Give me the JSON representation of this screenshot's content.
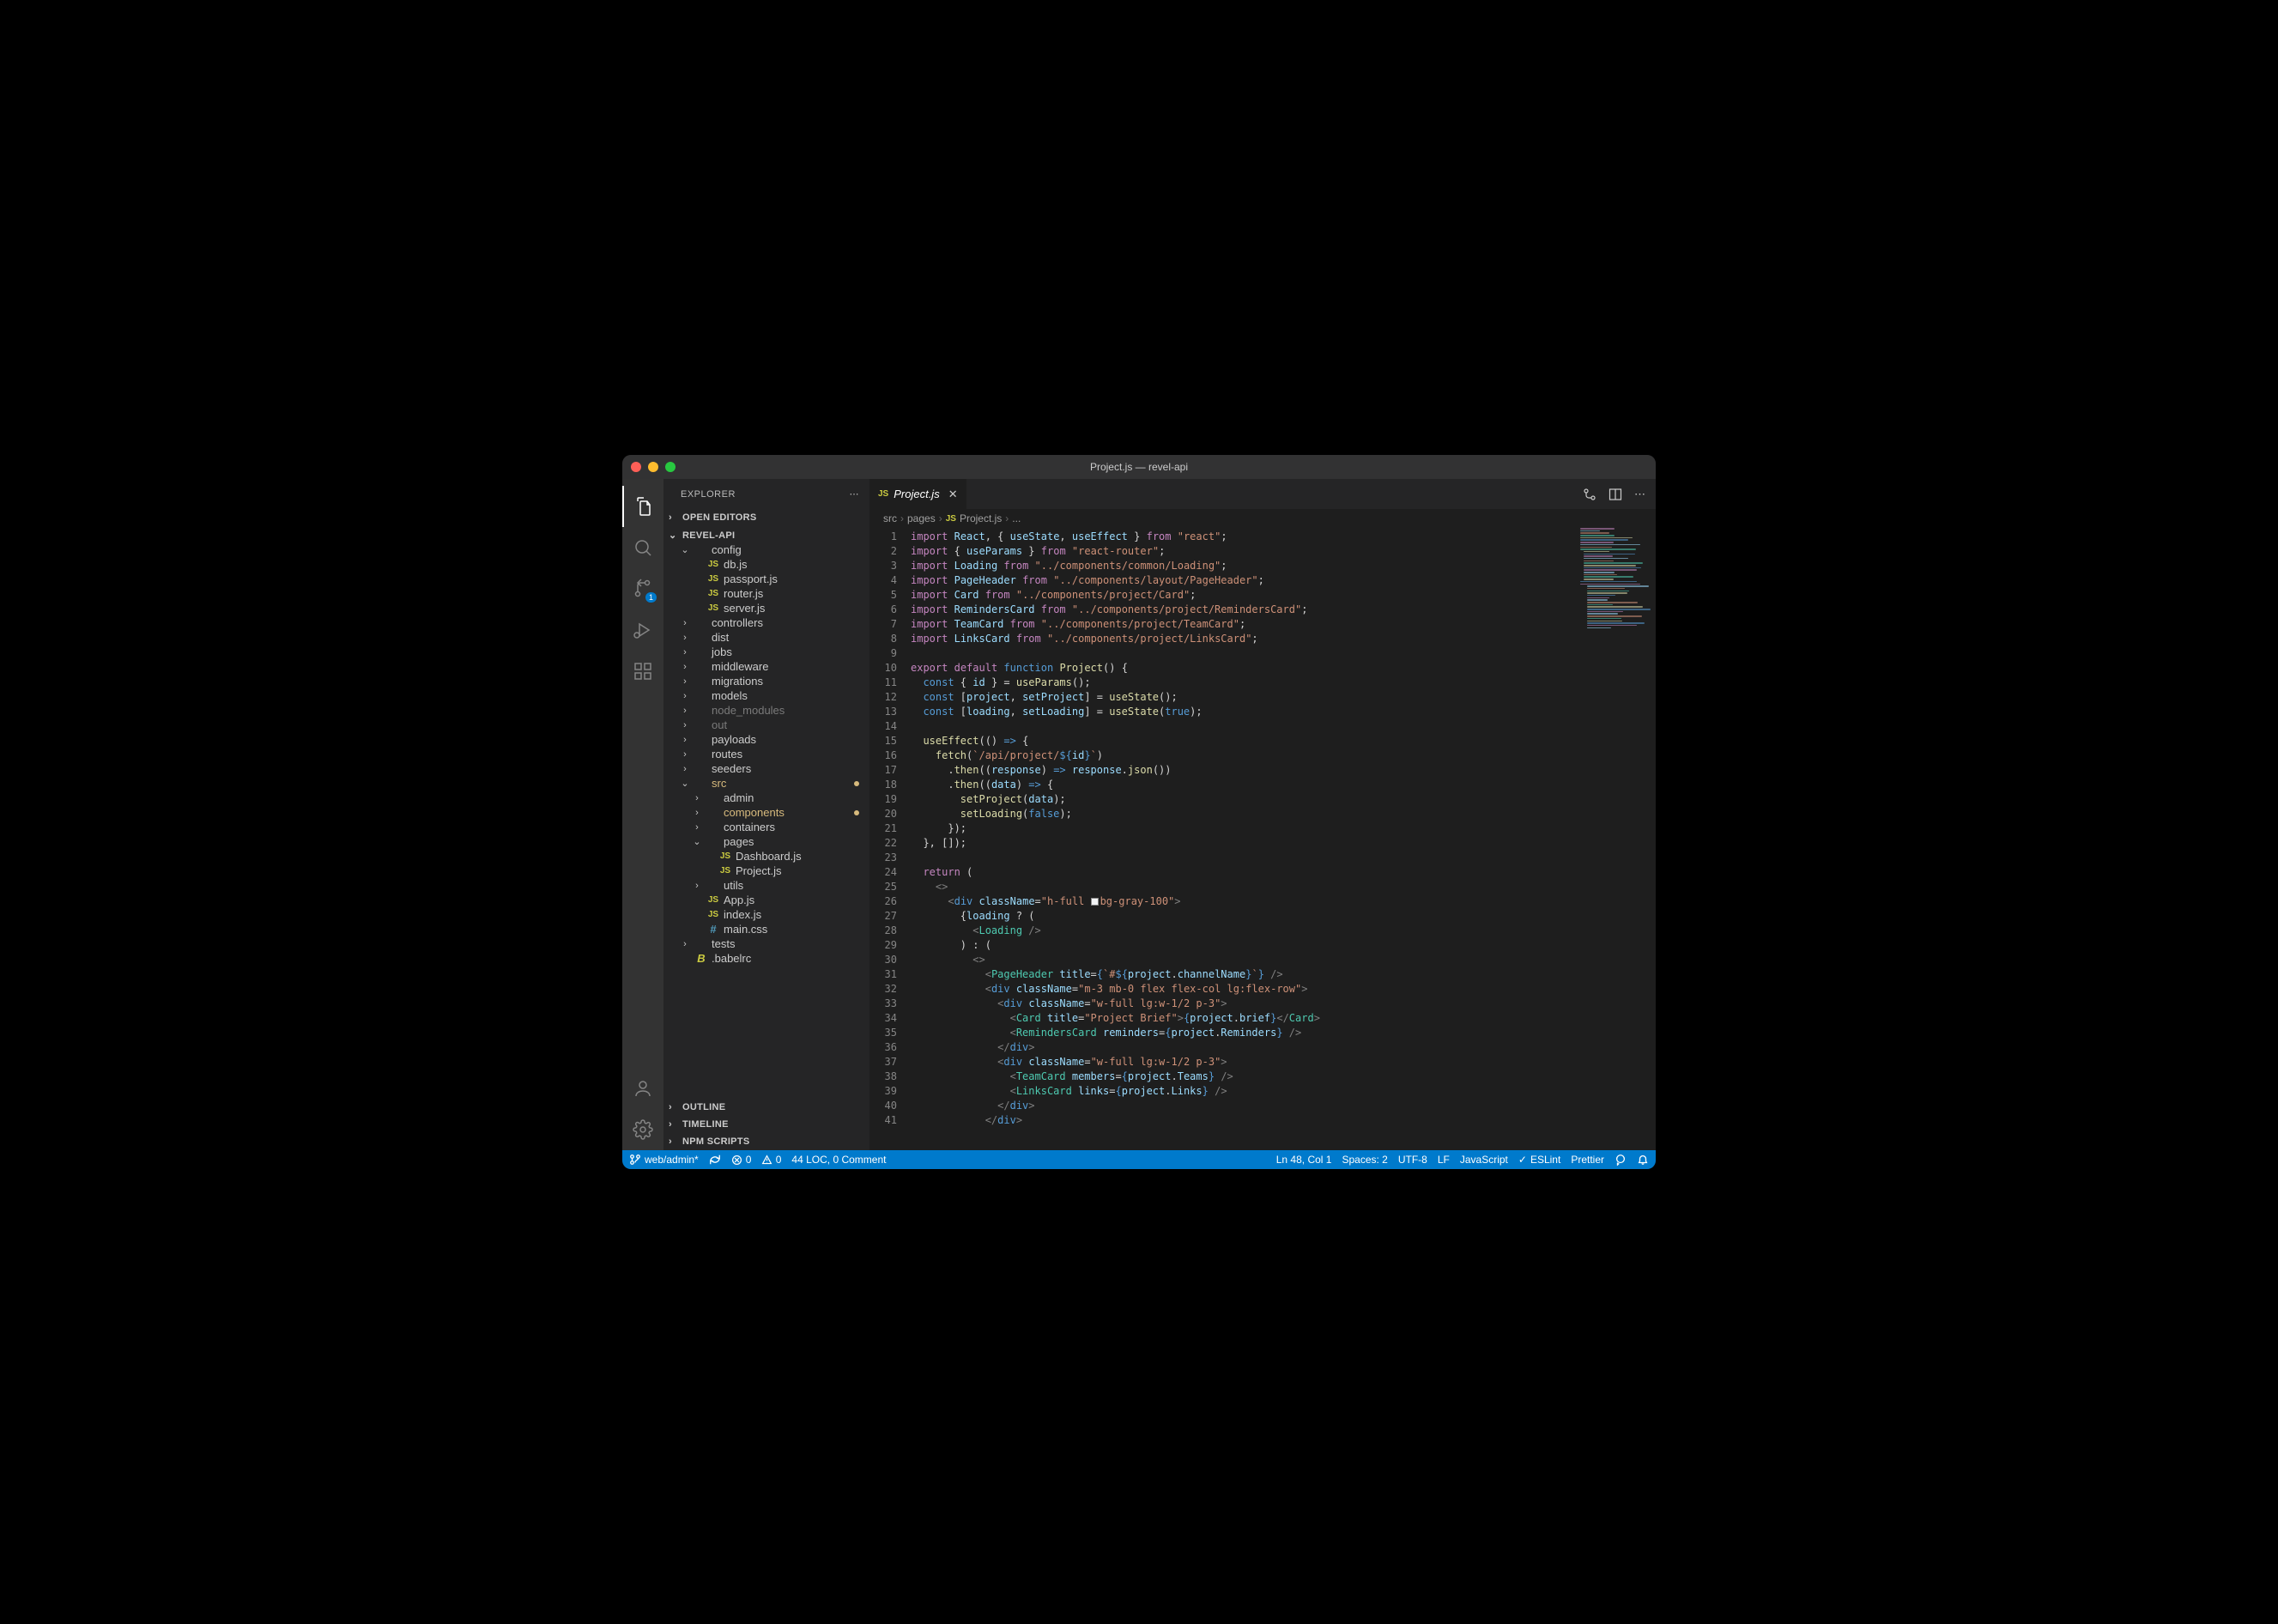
{
  "titlebar": {
    "title": "Project.js — revel-api"
  },
  "sidebar": {
    "title": "EXPLORER",
    "sections": {
      "open_editors": "OPEN EDITORS",
      "project": "REVEL-API",
      "outline": "OUTLINE",
      "timeline": "TIMELINE",
      "npm": "NPM SCRIPTS"
    },
    "tree": [
      {
        "d": 1,
        "t": "folder",
        "open": true,
        "label": "config"
      },
      {
        "d": 2,
        "t": "js",
        "label": "db.js"
      },
      {
        "d": 2,
        "t": "js",
        "label": "passport.js"
      },
      {
        "d": 2,
        "t": "js",
        "label": "router.js"
      },
      {
        "d": 2,
        "t": "js",
        "label": "server.js"
      },
      {
        "d": 1,
        "t": "folder",
        "label": "controllers"
      },
      {
        "d": 1,
        "t": "folder",
        "label": "dist"
      },
      {
        "d": 1,
        "t": "folder",
        "label": "jobs"
      },
      {
        "d": 1,
        "t": "folder",
        "label": "middleware"
      },
      {
        "d": 1,
        "t": "folder",
        "label": "migrations"
      },
      {
        "d": 1,
        "t": "folder",
        "label": "models"
      },
      {
        "d": 1,
        "t": "folder",
        "label": "node_modules",
        "dim": true
      },
      {
        "d": 1,
        "t": "folder",
        "label": "out",
        "dim": true
      },
      {
        "d": 1,
        "t": "folder",
        "label": "payloads"
      },
      {
        "d": 1,
        "t": "folder",
        "label": "routes"
      },
      {
        "d": 1,
        "t": "folder",
        "label": "seeders"
      },
      {
        "d": 1,
        "t": "folder",
        "open": true,
        "label": "src",
        "mod": true,
        "dot": true
      },
      {
        "d": 2,
        "t": "folder",
        "label": "admin"
      },
      {
        "d": 2,
        "t": "folder",
        "label": "components",
        "mod": true,
        "dot": true
      },
      {
        "d": 2,
        "t": "folder",
        "label": "containers"
      },
      {
        "d": 2,
        "t": "folder",
        "open": true,
        "label": "pages"
      },
      {
        "d": 3,
        "t": "js",
        "label": "Dashboard.js"
      },
      {
        "d": 3,
        "t": "js",
        "label": "Project.js"
      },
      {
        "d": 2,
        "t": "folder",
        "label": "utils"
      },
      {
        "d": 2,
        "t": "js",
        "label": "App.js"
      },
      {
        "d": 2,
        "t": "js",
        "label": "index.js"
      },
      {
        "d": 2,
        "t": "hash",
        "label": "main.css"
      },
      {
        "d": 1,
        "t": "folder",
        "label": "tests"
      },
      {
        "d": 1,
        "t": "babel",
        "label": ".babelrc"
      }
    ]
  },
  "scm_badge": "1",
  "tab": {
    "label": "Project.js"
  },
  "breadcrumb": [
    "src",
    "pages",
    "Project.js",
    "..."
  ],
  "code_lines": [
    [
      [
        "kw",
        "import"
      ],
      [
        "pun",
        " "
      ],
      [
        "id",
        "React"
      ],
      [
        "pun",
        ", { "
      ],
      [
        "id",
        "useState"
      ],
      [
        "pun",
        ", "
      ],
      [
        "id",
        "useEffect"
      ],
      [
        "pun",
        " } "
      ],
      [
        "kw",
        "from"
      ],
      [
        "pun",
        " "
      ],
      [
        "str",
        "\"react\""
      ],
      [
        "pun",
        ";"
      ]
    ],
    [
      [
        "kw",
        "import"
      ],
      [
        "pun",
        " { "
      ],
      [
        "id",
        "useParams"
      ],
      [
        "pun",
        " } "
      ],
      [
        "kw",
        "from"
      ],
      [
        "pun",
        " "
      ],
      [
        "str",
        "\"react-router\""
      ],
      [
        "pun",
        ";"
      ]
    ],
    [
      [
        "kw",
        "import"
      ],
      [
        "pun",
        " "
      ],
      [
        "id",
        "Loading"
      ],
      [
        "pun",
        " "
      ],
      [
        "kw",
        "from"
      ],
      [
        "pun",
        " "
      ],
      [
        "str",
        "\"../components/common/Loading\""
      ],
      [
        "pun",
        ";"
      ]
    ],
    [
      [
        "kw",
        "import"
      ],
      [
        "pun",
        " "
      ],
      [
        "id",
        "PageHeader"
      ],
      [
        "pun",
        " "
      ],
      [
        "kw",
        "from"
      ],
      [
        "pun",
        " "
      ],
      [
        "str",
        "\"../components/layout/PageHeader\""
      ],
      [
        "pun",
        ";"
      ]
    ],
    [
      [
        "kw",
        "import"
      ],
      [
        "pun",
        " "
      ],
      [
        "id",
        "Card"
      ],
      [
        "pun",
        " "
      ],
      [
        "kw",
        "from"
      ],
      [
        "pun",
        " "
      ],
      [
        "str",
        "\"../components/project/Card\""
      ],
      [
        "pun",
        ";"
      ]
    ],
    [
      [
        "kw",
        "import"
      ],
      [
        "pun",
        " "
      ],
      [
        "id",
        "RemindersCard"
      ],
      [
        "pun",
        " "
      ],
      [
        "kw",
        "from"
      ],
      [
        "pun",
        " "
      ],
      [
        "str",
        "\"../components/project/RemindersCard\""
      ],
      [
        "pun",
        ";"
      ]
    ],
    [
      [
        "kw",
        "import"
      ],
      [
        "pun",
        " "
      ],
      [
        "id",
        "TeamCard"
      ],
      [
        "pun",
        " "
      ],
      [
        "kw",
        "from"
      ],
      [
        "pun",
        " "
      ],
      [
        "str",
        "\"../components/project/TeamCard\""
      ],
      [
        "pun",
        ";"
      ]
    ],
    [
      [
        "kw",
        "import"
      ],
      [
        "pun",
        " "
      ],
      [
        "id",
        "LinksCard"
      ],
      [
        "pun",
        " "
      ],
      [
        "kw",
        "from"
      ],
      [
        "pun",
        " "
      ],
      [
        "str",
        "\"../components/project/LinksCard\""
      ],
      [
        "pun",
        ";"
      ]
    ],
    [],
    [
      [
        "kw",
        "export"
      ],
      [
        "pun",
        " "
      ],
      [
        "kw",
        "default"
      ],
      [
        "pun",
        " "
      ],
      [
        "const",
        "function"
      ],
      [
        "pun",
        " "
      ],
      [
        "fn",
        "Project"
      ],
      [
        "pun",
        "() {"
      ]
    ],
    [
      [
        "pun",
        "  "
      ],
      [
        "const",
        "const"
      ],
      [
        "pun",
        " { "
      ],
      [
        "id",
        "id"
      ],
      [
        "pun",
        " } = "
      ],
      [
        "fn",
        "useParams"
      ],
      [
        "pun",
        "();"
      ]
    ],
    [
      [
        "pun",
        "  "
      ],
      [
        "const",
        "const"
      ],
      [
        "pun",
        " ["
      ],
      [
        "id",
        "project"
      ],
      [
        "pun",
        ", "
      ],
      [
        "id",
        "setProject"
      ],
      [
        "pun",
        "] = "
      ],
      [
        "fn",
        "useState"
      ],
      [
        "pun",
        "();"
      ]
    ],
    [
      [
        "pun",
        "  "
      ],
      [
        "const",
        "const"
      ],
      [
        "pun",
        " ["
      ],
      [
        "id",
        "loading"
      ],
      [
        "pun",
        ", "
      ],
      [
        "id",
        "setLoading"
      ],
      [
        "pun",
        "] = "
      ],
      [
        "fn",
        "useState"
      ],
      [
        "pun",
        "("
      ],
      [
        "const",
        "true"
      ],
      [
        "pun",
        ");"
      ]
    ],
    [],
    [
      [
        "pun",
        "  "
      ],
      [
        "fn",
        "useEffect"
      ],
      [
        "pun",
        "(() "
      ],
      [
        "const",
        "=>"
      ],
      [
        "pun",
        " {"
      ]
    ],
    [
      [
        "pun",
        "    "
      ],
      [
        "fn",
        "fetch"
      ],
      [
        "pun",
        "("
      ],
      [
        "str",
        "`/api/project/"
      ],
      [
        "const",
        "${"
      ],
      [
        "id",
        "id"
      ],
      [
        "const",
        "}"
      ],
      [
        "str",
        "`"
      ],
      [
        "pun",
        ")"
      ]
    ],
    [
      [
        "pun",
        "      ."
      ],
      [
        "fn",
        "then"
      ],
      [
        "pun",
        "(("
      ],
      [
        "id",
        "response"
      ],
      [
        "pun",
        ") "
      ],
      [
        "const",
        "=>"
      ],
      [
        "pun",
        " "
      ],
      [
        "id",
        "response"
      ],
      [
        "pun",
        "."
      ],
      [
        "fn",
        "json"
      ],
      [
        "pun",
        "())"
      ]
    ],
    [
      [
        "pun",
        "      ."
      ],
      [
        "fn",
        "then"
      ],
      [
        "pun",
        "(("
      ],
      [
        "id",
        "data"
      ],
      [
        "pun",
        ") "
      ],
      [
        "const",
        "=>"
      ],
      [
        "pun",
        " {"
      ]
    ],
    [
      [
        "pun",
        "        "
      ],
      [
        "fn",
        "setProject"
      ],
      [
        "pun",
        "("
      ],
      [
        "id",
        "data"
      ],
      [
        "pun",
        ");"
      ]
    ],
    [
      [
        "pun",
        "        "
      ],
      [
        "fn",
        "setLoading"
      ],
      [
        "pun",
        "("
      ],
      [
        "const",
        "false"
      ],
      [
        "pun",
        ");"
      ]
    ],
    [
      [
        "pun",
        "      });"
      ]
    ],
    [
      [
        "pun",
        "  }, []);"
      ]
    ],
    [],
    [
      [
        "pun",
        "  "
      ],
      [
        "kw",
        "return"
      ],
      [
        "pun",
        " ("
      ]
    ],
    [
      [
        "pun",
        "    "
      ],
      [
        "br",
        "<>"
      ]
    ],
    [
      [
        "pun",
        "      "
      ],
      [
        "br",
        "<"
      ],
      [
        "const",
        "div"
      ],
      [
        "pun",
        " "
      ],
      [
        "attr",
        "className"
      ],
      [
        "pun",
        "="
      ],
      [
        "str",
        "\"h-full "
      ],
      [
        "colorbox",
        ""
      ],
      [
        "str",
        "bg-gray-100\""
      ],
      [
        "br",
        ">"
      ]
    ],
    [
      [
        "pun",
        "        {"
      ],
      [
        "id",
        "loading"
      ],
      [
        "pun",
        " ? ("
      ]
    ],
    [
      [
        "pun",
        "          "
      ],
      [
        "br",
        "<"
      ],
      [
        "tag",
        "Loading"
      ],
      [
        "pun",
        " "
      ],
      [
        "br",
        "/>"
      ]
    ],
    [
      [
        "pun",
        "        ) : ("
      ]
    ],
    [
      [
        "pun",
        "          "
      ],
      [
        "br",
        "<>"
      ]
    ],
    [
      [
        "pun",
        "            "
      ],
      [
        "br",
        "<"
      ],
      [
        "tag",
        "PageHeader"
      ],
      [
        "pun",
        " "
      ],
      [
        "attr",
        "title"
      ],
      [
        "pun",
        "="
      ],
      [
        "const",
        "{"
      ],
      [
        "str",
        "`#"
      ],
      [
        "const",
        "${"
      ],
      [
        "id",
        "project"
      ],
      [
        "pun",
        "."
      ],
      [
        "id",
        "channelName"
      ],
      [
        "const",
        "}"
      ],
      [
        "str",
        "`"
      ],
      [
        "const",
        "}"
      ],
      [
        "pun",
        " "
      ],
      [
        "br",
        "/>"
      ]
    ],
    [
      [
        "pun",
        "            "
      ],
      [
        "br",
        "<"
      ],
      [
        "const",
        "div"
      ],
      [
        "pun",
        " "
      ],
      [
        "attr",
        "className"
      ],
      [
        "pun",
        "="
      ],
      [
        "str",
        "\"m-3 mb-0 flex flex-col lg:flex-row\""
      ],
      [
        "br",
        ">"
      ]
    ],
    [
      [
        "pun",
        "              "
      ],
      [
        "br",
        "<"
      ],
      [
        "const",
        "div"
      ],
      [
        "pun",
        " "
      ],
      [
        "attr",
        "className"
      ],
      [
        "pun",
        "="
      ],
      [
        "str",
        "\"w-full lg:w-1/2 p-3\""
      ],
      [
        "br",
        ">"
      ]
    ],
    [
      [
        "pun",
        "                "
      ],
      [
        "br",
        "<"
      ],
      [
        "tag",
        "Card"
      ],
      [
        "pun",
        " "
      ],
      [
        "attr",
        "title"
      ],
      [
        "pun",
        "="
      ],
      [
        "str",
        "\"Project Brief\""
      ],
      [
        "br",
        ">"
      ],
      [
        "const",
        "{"
      ],
      [
        "id",
        "project"
      ],
      [
        "pun",
        "."
      ],
      [
        "id",
        "brief"
      ],
      [
        "const",
        "}"
      ],
      [
        "br",
        "</"
      ],
      [
        "tag",
        "Card"
      ],
      [
        "br",
        ">"
      ]
    ],
    [
      [
        "pun",
        "                "
      ],
      [
        "br",
        "<"
      ],
      [
        "tag",
        "RemindersCard"
      ],
      [
        "pun",
        " "
      ],
      [
        "attr",
        "reminders"
      ],
      [
        "pun",
        "="
      ],
      [
        "const",
        "{"
      ],
      [
        "id",
        "project"
      ],
      [
        "pun",
        "."
      ],
      [
        "id",
        "Reminders"
      ],
      [
        "const",
        "}"
      ],
      [
        "pun",
        " "
      ],
      [
        "br",
        "/>"
      ]
    ],
    [
      [
        "pun",
        "              "
      ],
      [
        "br",
        "</"
      ],
      [
        "const",
        "div"
      ],
      [
        "br",
        ">"
      ]
    ],
    [
      [
        "pun",
        "              "
      ],
      [
        "br",
        "<"
      ],
      [
        "const",
        "div"
      ],
      [
        "pun",
        " "
      ],
      [
        "attr",
        "className"
      ],
      [
        "pun",
        "="
      ],
      [
        "str",
        "\"w-full lg:w-1/2 p-3\""
      ],
      [
        "br",
        ">"
      ]
    ],
    [
      [
        "pun",
        "                "
      ],
      [
        "br",
        "<"
      ],
      [
        "tag",
        "TeamCard"
      ],
      [
        "pun",
        " "
      ],
      [
        "attr",
        "members"
      ],
      [
        "pun",
        "="
      ],
      [
        "const",
        "{"
      ],
      [
        "id",
        "project"
      ],
      [
        "pun",
        "."
      ],
      [
        "id",
        "Teams"
      ],
      [
        "const",
        "}"
      ],
      [
        "pun",
        " "
      ],
      [
        "br",
        "/>"
      ]
    ],
    [
      [
        "pun",
        "                "
      ],
      [
        "br",
        "<"
      ],
      [
        "tag",
        "LinksCard"
      ],
      [
        "pun",
        " "
      ],
      [
        "attr",
        "links"
      ],
      [
        "pun",
        "="
      ],
      [
        "const",
        "{"
      ],
      [
        "id",
        "project"
      ],
      [
        "pun",
        "."
      ],
      [
        "id",
        "Links"
      ],
      [
        "const",
        "}"
      ],
      [
        "pun",
        " "
      ],
      [
        "br",
        "/>"
      ]
    ],
    [
      [
        "pun",
        "              "
      ],
      [
        "br",
        "</"
      ],
      [
        "const",
        "div"
      ],
      [
        "br",
        ">"
      ]
    ],
    [
      [
        "pun",
        "            "
      ],
      [
        "br",
        "</"
      ],
      [
        "const",
        "div"
      ],
      [
        "br",
        ">"
      ]
    ]
  ],
  "statusbar": {
    "branch": "web/admin*",
    "errors": "0",
    "warnings": "0",
    "loc": "44 LOC, 0 Comment",
    "pos": "Ln 48, Col 1",
    "spaces": "Spaces: 2",
    "encoding": "UTF-8",
    "eol": "LF",
    "lang": "JavaScript",
    "eslint": "ESLint",
    "prettier": "Prettier"
  }
}
